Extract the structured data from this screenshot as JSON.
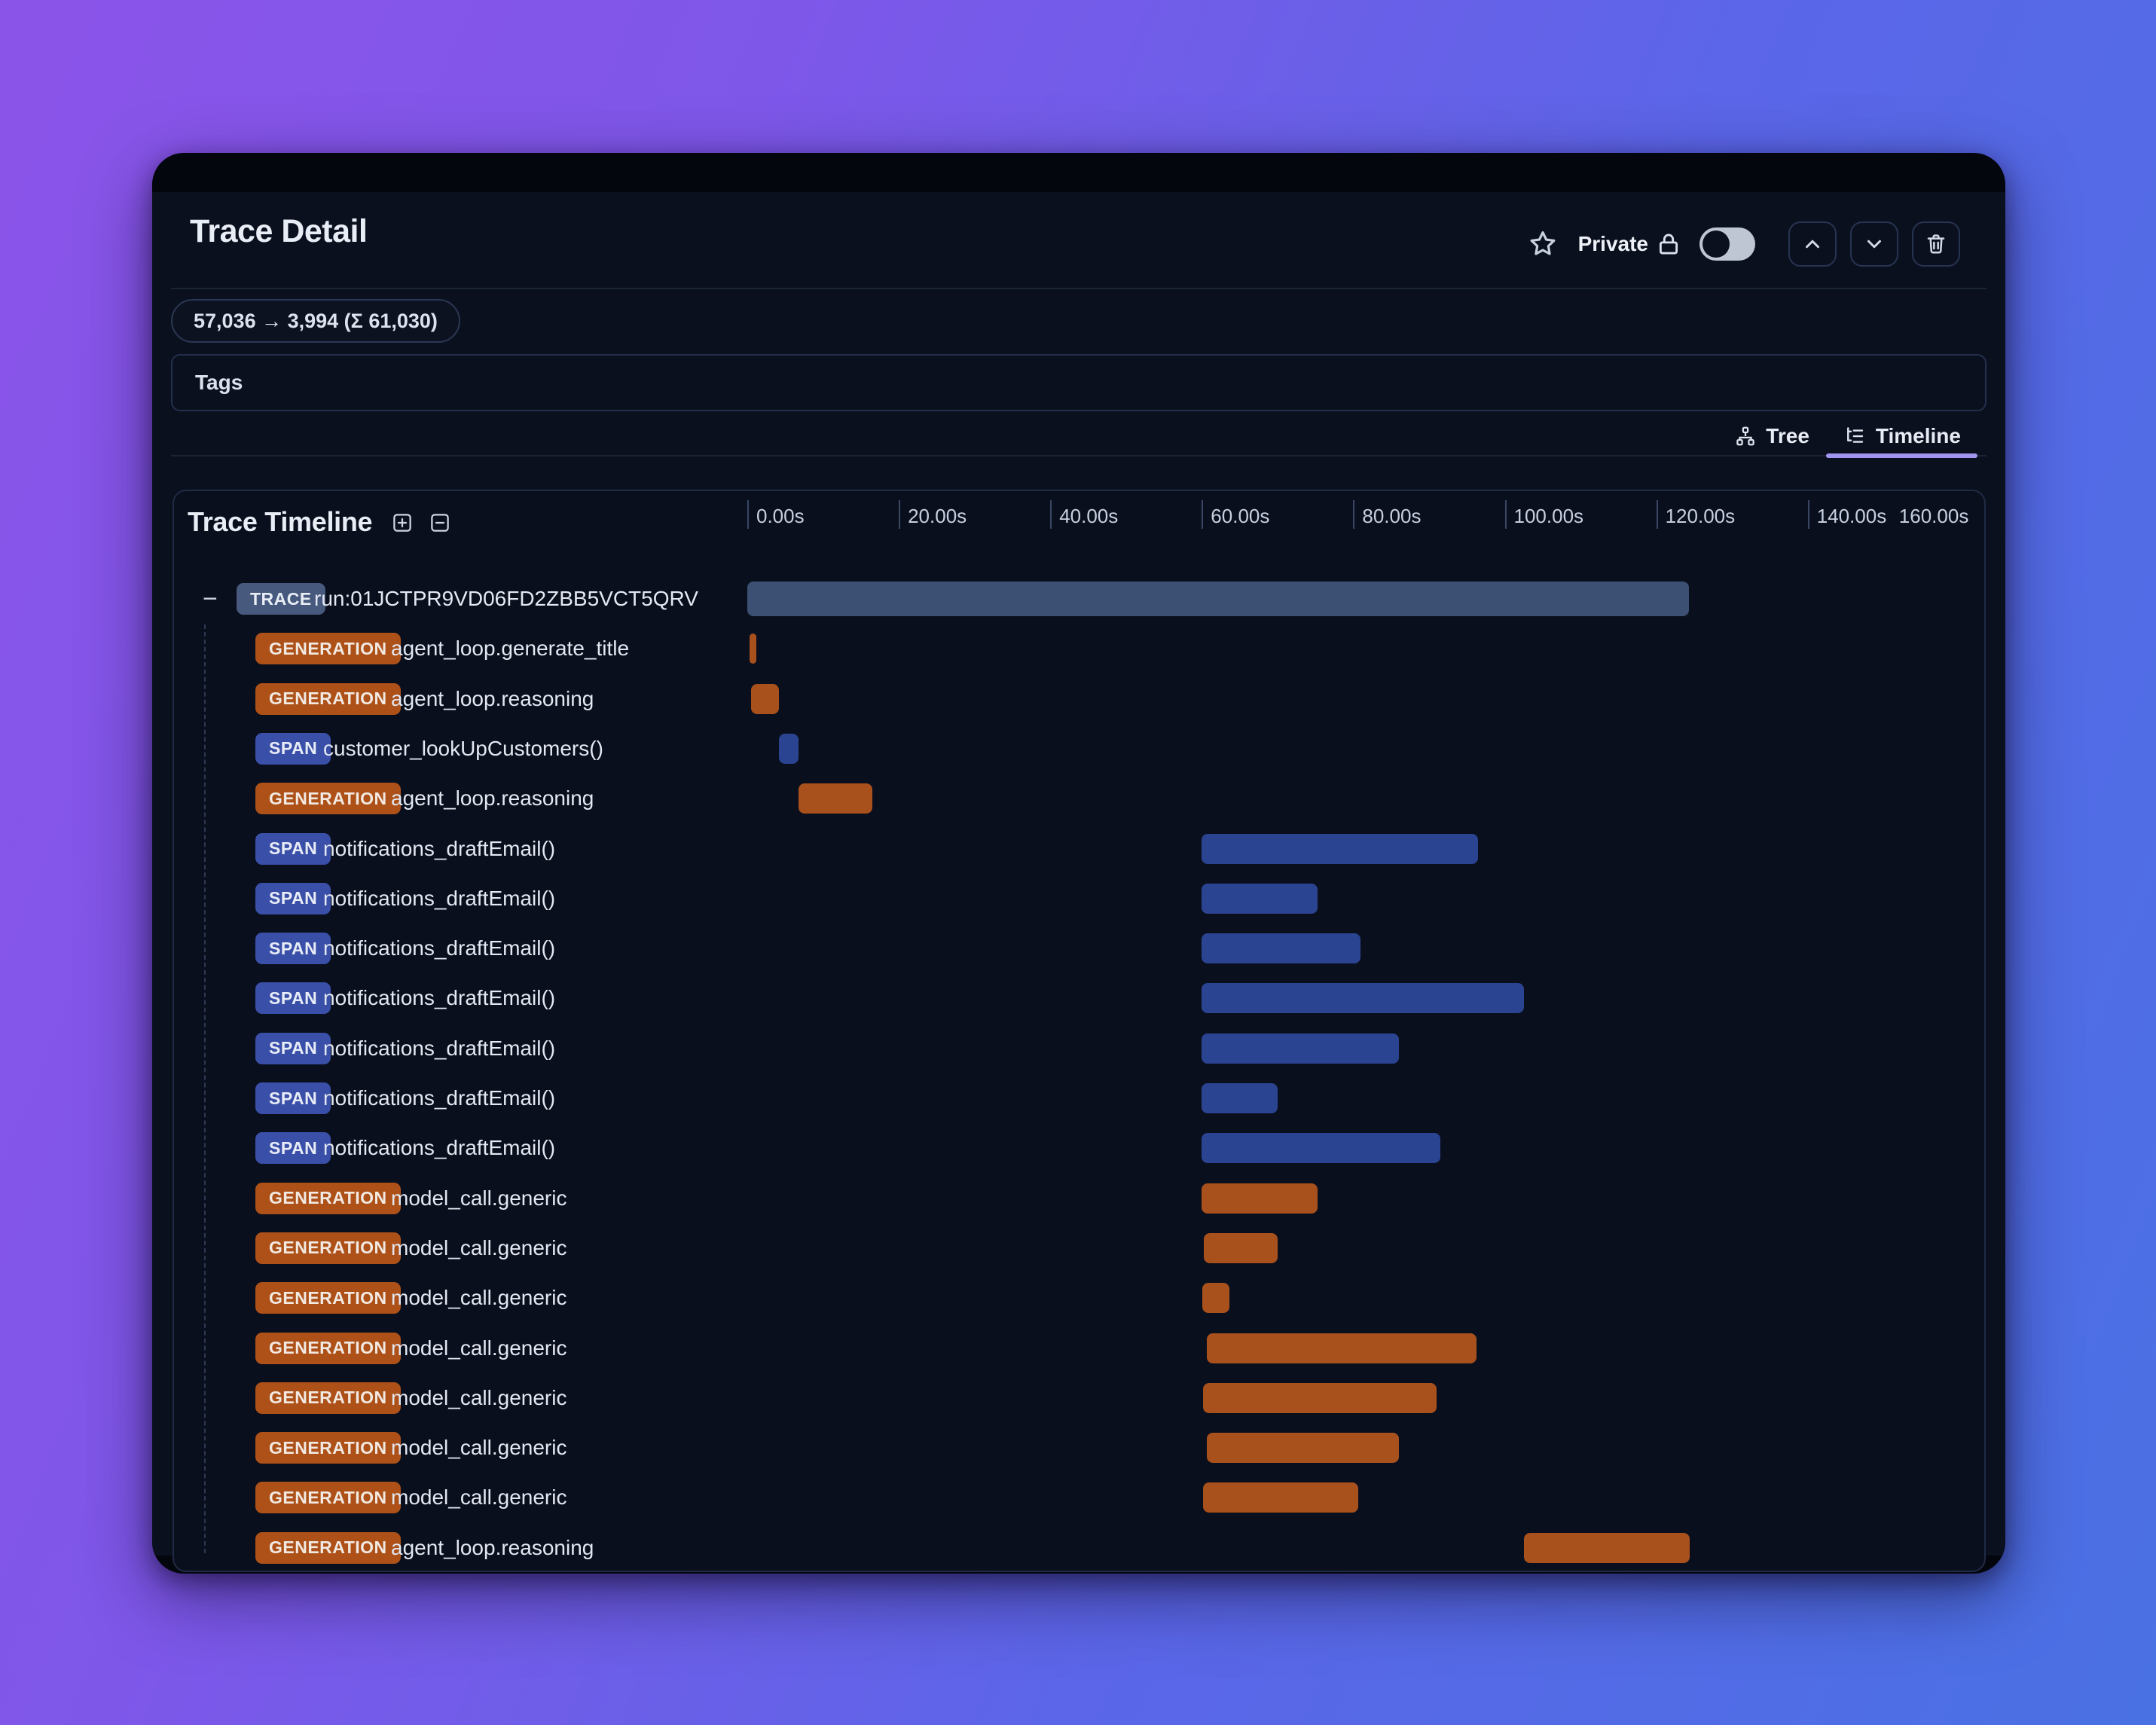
{
  "header": {
    "title": "Trace Detail",
    "private_label": "Private",
    "toggle_state": "off"
  },
  "token_badge": {
    "text": "57,036 → 3,994 (Σ 61,030)"
  },
  "tags": {
    "label": "Tags"
  },
  "tabs": [
    {
      "label": "Tree",
      "icon": "tree-icon",
      "active": false
    },
    {
      "label": "Timeline",
      "icon": "timeline-icon",
      "active": true
    }
  ],
  "timeline": {
    "title": "Trace Timeline",
    "axis": {
      "tick_labels": [
        "0.00s",
        "20.00s",
        "40.00s",
        "60.00s",
        "80.00s",
        "100.00s",
        "120.00s",
        "140.00s",
        "160.00s"
      ],
      "max_seconds": 160
    },
    "rows": [
      {
        "type": "TRACE",
        "label": "run:01JCTPR9VD06FD2ZBB5VCT5QRV",
        "start": 0,
        "end": 124.3,
        "collapsible": true
      },
      {
        "type": "GENERATION",
        "label": "agent_loop.generate_title",
        "start": 0.3,
        "end": 1.2
      },
      {
        "type": "GENERATION",
        "label": "agent_loop.reasoning",
        "start": 0.5,
        "end": 4.2
      },
      {
        "type": "SPAN",
        "label": "customer_lookUpCustomers()",
        "start": 4.2,
        "end": 6.8
      },
      {
        "type": "GENERATION",
        "label": "agent_loop.reasoning",
        "start": 6.8,
        "end": 16.5
      },
      {
        "type": "SPAN",
        "label": "notifications_draftEmail()",
        "start": 60.0,
        "end": 96.5
      },
      {
        "type": "SPAN",
        "label": "notifications_draftEmail()",
        "start": 60.0,
        "end": 75.3
      },
      {
        "type": "SPAN",
        "label": "notifications_draftEmail()",
        "start": 60.0,
        "end": 81.0
      },
      {
        "type": "SPAN",
        "label": "notifications_draftEmail()",
        "start": 60.0,
        "end": 102.5
      },
      {
        "type": "SPAN",
        "label": "notifications_draftEmail()",
        "start": 60.0,
        "end": 86.0
      },
      {
        "type": "SPAN",
        "label": "notifications_draftEmail()",
        "start": 60.0,
        "end": 70.0
      },
      {
        "type": "SPAN",
        "label": "notifications_draftEmail()",
        "start": 60.0,
        "end": 91.5
      },
      {
        "type": "GENERATION",
        "label": "model_call.generic",
        "start": 60.0,
        "end": 75.3
      },
      {
        "type": "GENERATION",
        "label": "model_call.generic",
        "start": 60.3,
        "end": 70.0
      },
      {
        "type": "GENERATION",
        "label": "model_call.generic",
        "start": 60.1,
        "end": 63.7
      },
      {
        "type": "GENERATION",
        "label": "model_call.generic",
        "start": 60.7,
        "end": 96.3
      },
      {
        "type": "GENERATION",
        "label": "model_call.generic",
        "start": 60.2,
        "end": 91.0
      },
      {
        "type": "GENERATION",
        "label": "model_call.generic",
        "start": 60.7,
        "end": 86.0
      },
      {
        "type": "GENERATION",
        "label": "model_call.generic",
        "start": 60.2,
        "end": 80.7
      },
      {
        "type": "GENERATION",
        "label": "agent_loop.reasoning",
        "start": 102.5,
        "end": 124.4
      }
    ]
  },
  "colors": {
    "accent_purple": "#a295f2",
    "generation_badge": "#ad5118",
    "generation_bar": "#a8511c",
    "span_badge": "#3a4fa8",
    "span_bar": "#2b4491",
    "trace_badge": "#47597c",
    "trace_bar": "#3c5073",
    "toggle_track": "#bfc6d3"
  }
}
